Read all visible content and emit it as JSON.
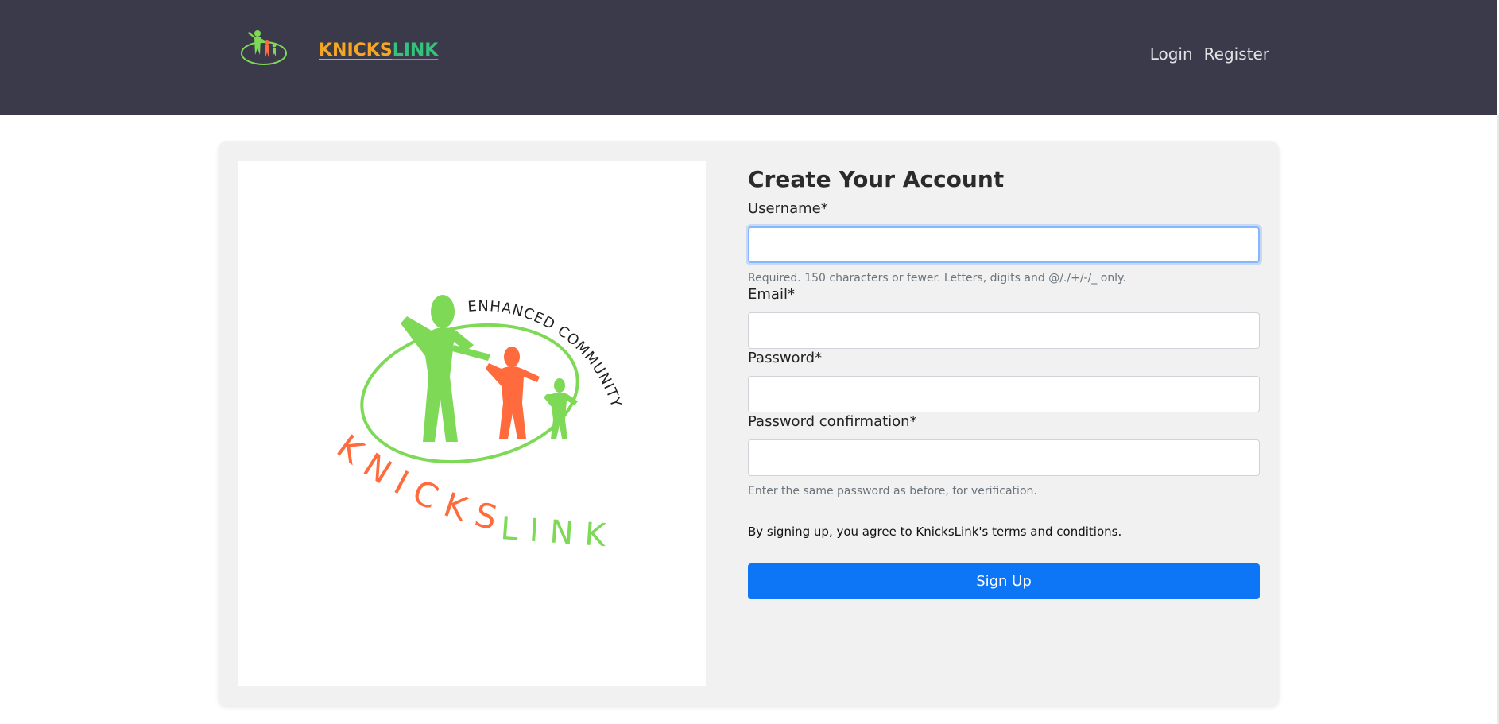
{
  "navbar": {
    "brand_part1": "KNICKS",
    "brand_part2": "LINK",
    "links": [
      "Login",
      "Register"
    ]
  },
  "logo_image": {
    "arc_text": "ENHANCED COMMUNITY",
    "bottom_text_left": "KNICKS",
    "bottom_text_right": "LINK"
  },
  "form": {
    "title": "Create Your Account",
    "username_label": "Username*",
    "username_value": "",
    "username_help": "Required. 150 characters or fewer. Letters, digits and @/./+/-/_ only.",
    "email_label": "Email*",
    "email_value": "",
    "password_label": "Password*",
    "password_value": "",
    "password_confirm_label": "Password confirmation*",
    "password_confirm_value": "",
    "password_confirm_help": "Enter the same password as before, for verification.",
    "terms_text": "By signing up, you agree to KnicksLink's terms and conditions.",
    "submit_label": "Sign Up"
  },
  "colors": {
    "navbar_bg": "#3b3a4a",
    "brand_orange": "#f5a623",
    "brand_green": "#34c37a",
    "logo_green": "#7ed957",
    "logo_orange": "#ff6b3d",
    "button_blue": "#0d76f7"
  }
}
